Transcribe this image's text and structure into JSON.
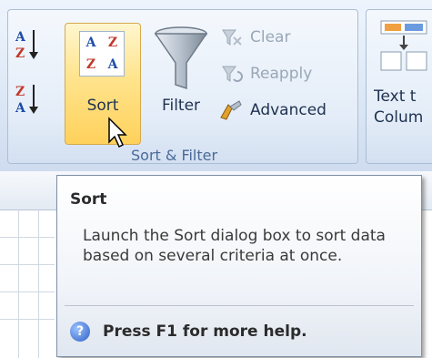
{
  "ribbon": {
    "sort_filter_group": {
      "label": "Sort & Filter",
      "sort_asc_icon_text": "A↓Z",
      "sort_desc_icon_text": "Z↓A",
      "sort": {
        "label": "Sort",
        "icon_cells": [
          "A",
          "Z",
          "Z",
          "A"
        ]
      },
      "filter": {
        "label": "Filter"
      },
      "clear": {
        "label": "Clear"
      },
      "reapply": {
        "label": "Reapply"
      },
      "advanced": {
        "label": "Advanced"
      }
    },
    "data_tools_group": {
      "text_to_columns_line1": "Text t",
      "text_to_columns_line2": "Colum"
    }
  },
  "tooltip": {
    "title": "Sort",
    "body": "Launch the Sort dialog box to sort data based on several criteria at once.",
    "help": "Press F1 for more help."
  },
  "colors": {
    "hover_highlight": "#ffd15c",
    "ribbon_bg": "#dde8f6",
    "disabled_text": "#9aa7b8",
    "label_text": "#1f3150"
  }
}
